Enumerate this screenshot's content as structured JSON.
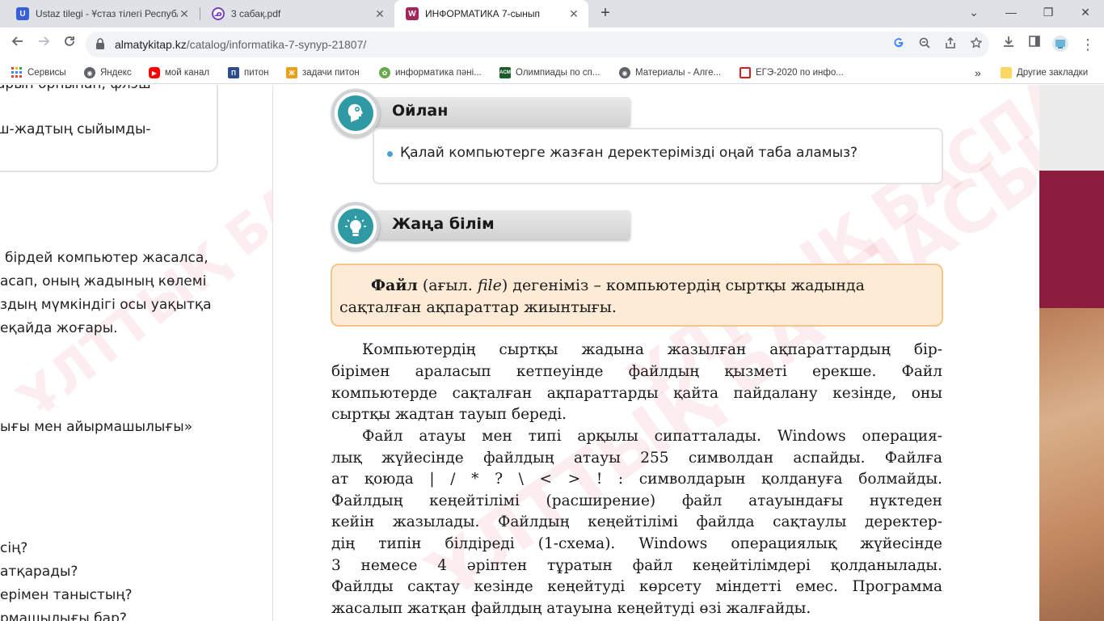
{
  "colors": {
    "tabstrip": "#dee1e6",
    "accent_teal": "#2f9aa3",
    "definition_bg": "#fdebd5",
    "definition_border": "#f5c488"
  },
  "tabs": [
    {
      "title": "Ustaz tilegi - Ұстаз тілегі Республ",
      "favicon": "ustaz-u-icon",
      "active": false
    },
    {
      "title": "3 сабақ.pdf",
      "favicon": "pdf-viewer-icon",
      "active": false
    },
    {
      "title": "ИНФОРМАТИКА 7-сынып",
      "favicon": "almatykitap-icon",
      "active": true
    }
  ],
  "tab_close_glyph": "✕",
  "new_tab_glyph": "+",
  "window_controls": {
    "chevron": "⌄",
    "minimize": "—",
    "restore": "❐",
    "close": "✕"
  },
  "address_bar": {
    "host": "almatykitap.kz",
    "path": "/catalog/informatika-7-synyp-21807/"
  },
  "bookmarks": [
    {
      "label": "Сервисы",
      "icon": "apps-grid-icon"
    },
    {
      "label": "Яндекс",
      "icon": "globe-icon"
    },
    {
      "label": "мой канал",
      "icon": "youtube-icon"
    },
    {
      "label": "питон",
      "icon": "bookmark-blue-icon"
    },
    {
      "label": "задачи питон",
      "icon": "bookmark-gold-icon"
    },
    {
      "label": "информатика пәні...",
      "icon": "bookmark-leaf-icon"
    },
    {
      "label": "Олимпиады по сп...",
      "icon": "acm-icon"
    },
    {
      "label": "Материалы - Алге...",
      "icon": "globe-icon"
    },
    {
      "label": "ЕГЭ-2020 по инфо...",
      "icon": "bookmark-red-icon"
    }
  ],
  "bookmarks_overflow": "»",
  "other_bookmarks": "Другие закладки",
  "left_page": {
    "lines": [
      "арын орнынан, флэш",
      "ш-жадтың сыйымды-",
      "бірдей компьютер жасалса,",
      "асап, оның жадының көлемі",
      "здың мүмкіндігі осы уақытқа",
      "еқайда жоғары.",
      "ығы   мен   айырмашылығы»",
      "сің?",
      "атқарады?",
      "ерімен таныстың?",
      "рмашылығы бар?"
    ]
  },
  "main_page": {
    "think": {
      "title": "Ойлан",
      "question": "Қалай компьютерге жазған деректерімізді оңай таба аламыз?"
    },
    "new_knowledge": {
      "title": "Жаңа білім"
    },
    "definition": {
      "term": "Файл",
      "open_paren": " (",
      "lang": "ағыл. ",
      "english": "file",
      "rest_line1": ") дегеніміз – компьютердің сыртқы жадында",
      "line2": "сақталған ақпараттар жиынтығы."
    },
    "body_lines": [
      "Компьютердің сыртқы жадына жазылған ақпараттардың бір-",
      "бірімен араласып кетпеуінде файлдың қызметі ерекше. Файл",
      "компьютерде сақталған ақпараттарды қайта пайдалану кезінде, оны",
      "сыртқы жадтан тауып береді.",
      "Файл атауы мен типі арқылы сипатталады. Windows операция-",
      "лық жүйесінде файлдың атауы 255 символдан аспайды. Файлға",
      "ат қоюда | / * ? \\ < > ! : символдарын қолдануға болмайды.",
      "Файлдың кеңейтілімі (расширение) файл атауындағы нүктеден",
      "кейін жазылады. Файлдың кеңейтілімі файлда сақтаулы деректер-",
      "дің типін білдіреді (1-схема). Windows операциялық жүйесінде",
      "3 немесе 4 әріптен тұратын файл кеңейтілімдері қолданылады.",
      "Файлды сақтау кезінде кеңейтуді көрсету міндетті емес. Программа",
      "жасалып жатқан файлдың атауына кеңейтуді өзі жалғайды."
    ],
    "watermark": "ҰЛТТЫҚ  БАСПАСЫ"
  }
}
